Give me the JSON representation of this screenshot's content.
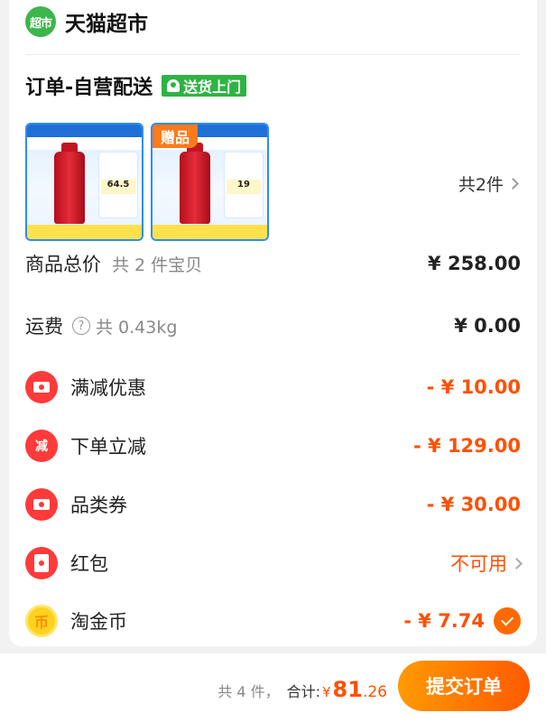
{
  "store": {
    "logo_text": "超市",
    "name": "天猫超市",
    "brand_color": "#3cb64a"
  },
  "order": {
    "title": "订单-自营配送",
    "delivery_badge": "送货上门"
  },
  "products": [
    {
      "gift_tag": "",
      "price_tag": "64.5"
    },
    {
      "gift_tag": "赠品",
      "price_tag": "19"
    }
  ],
  "item_count_link": "共2件",
  "summary": {
    "goods_total": {
      "label": "商品总价",
      "sub": "共 2 件宝贝",
      "value": "¥ 258.00"
    },
    "shipping": {
      "label": "运费",
      "sub": "共 0.43kg",
      "value": "¥ 0.00"
    }
  },
  "discounts": [
    {
      "label": "满减优惠",
      "value": "- ¥ 10.00",
      "icon": "ticket-icon"
    },
    {
      "label": "下单立减",
      "value": "- ¥ 129.00",
      "icon": "reduce-icon",
      "icon_text": "减"
    },
    {
      "label": "品类券",
      "value": "- ¥ 30.00",
      "icon": "ticket-icon"
    },
    {
      "label": "红包",
      "value": "不可用",
      "icon": "red-envelope-icon"
    },
    {
      "label": "淘金币",
      "value": "- ¥ 7.74",
      "icon": "coin-icon",
      "icon_text": "币"
    }
  ],
  "footer": {
    "count": "共 4 件，",
    "total_label": "合计:",
    "currency": "¥",
    "total_int": "81",
    "total_dec": ".26",
    "submit": "提交订单"
  },
  "colors": {
    "accent": "#ff5000",
    "button_from": "#ff9a00",
    "button_to": "#ff5a00"
  }
}
